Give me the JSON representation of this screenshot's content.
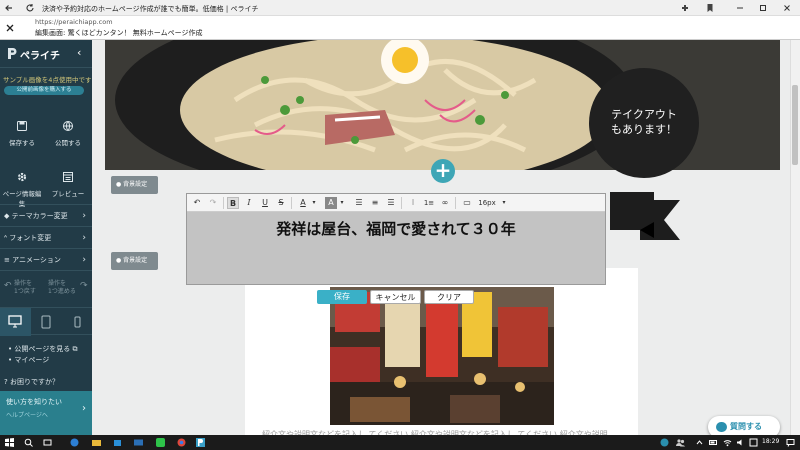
{
  "browser": {
    "title": "決済や予約対応のホームページ作成が誰でも簡単。低価格 | ペライチ",
    "url": "https://peraichiapp.com",
    "subtitle": "編集画面: 驚くほどカンタン！ 無料ホームページ作成"
  },
  "sidebar": {
    "logo": "ペライチ",
    "notice": "サンプル画像を4点使用中です",
    "pill": "公開前画像を購入する",
    "buttons": [
      {
        "label": "保存する",
        "icon": "save-icon"
      },
      {
        "label": "公開する",
        "icon": "globe-icon"
      },
      {
        "label": "ページ情報編集",
        "icon": "gear-icon"
      },
      {
        "label": "プレビュー",
        "icon": "preview-icon"
      }
    ],
    "menu": [
      {
        "label": "テーマカラー変更"
      },
      {
        "label": "フォント変更"
      },
      {
        "label": "アニメーション"
      }
    ],
    "undo": {
      "line1": "操作を",
      "line2": "1つ戻す"
    },
    "redo": {
      "line1": "操作を",
      "line2": "1つ進める"
    },
    "links": [
      "公開ページを見る",
      "マイページ"
    ],
    "question": "お困りですか？",
    "help_title": "使い方を知りたい",
    "help_sub": "ヘルプページへ"
  },
  "canvas": {
    "circle_line1": "テイクアウト",
    "circle_line2": "もあります！",
    "bg_setting_1": "背景設定",
    "bg_setting_2": "背景設定",
    "body_text": "紹介文や説明文などを記入し てください 紹介文や説明文などを記入し てください 紹介文や説明"
  },
  "editor": {
    "heading": "発祥は屋台、福岡で愛されて３０年",
    "font_size": "16px",
    "save": "保存",
    "cancel": "キャンセル",
    "clear": "クリア"
  },
  "chat": {
    "label": "質問する"
  },
  "taskbar": {
    "time": "18:29"
  },
  "colors": {
    "sidebar": "#223b47",
    "accent": "#3ab0c7",
    "help": "#2a7f8d"
  }
}
